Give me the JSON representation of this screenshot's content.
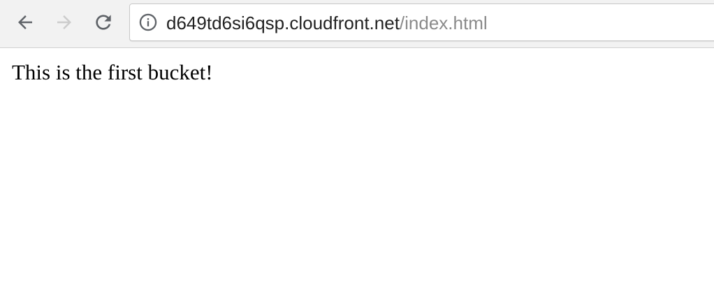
{
  "toolbar": {
    "back_icon": "arrow-left-icon",
    "forward_icon": "arrow-right-icon",
    "reload_icon": "reload-icon",
    "address_bar": {
      "security_icon": "info-icon",
      "host": "d649td6si6qsp.cloudfront.net",
      "path": "/index.html"
    }
  },
  "page": {
    "text": "This is the first bucket!"
  },
  "colors": {
    "toolbar_bg": "#f2f2f2",
    "url_host": "#222222",
    "url_path": "#8a8a8a",
    "icon_active": "#5f6368",
    "icon_disabled": "#cccccc"
  }
}
